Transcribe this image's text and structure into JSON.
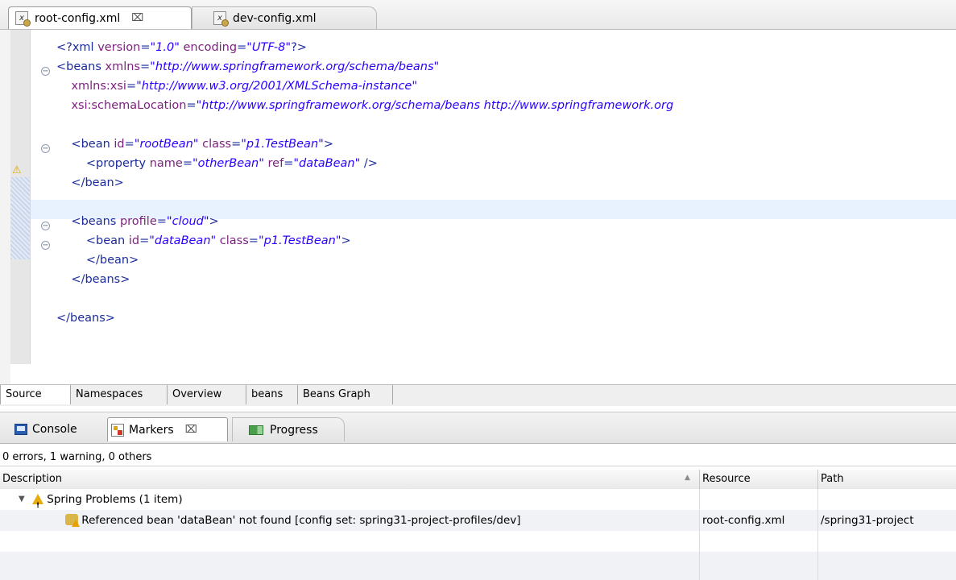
{
  "editor": {
    "tabs": [
      {
        "label": "root-config.xml",
        "close": "⌧"
      },
      {
        "label": "dev-config.xml"
      }
    ],
    "code_lines": [
      [
        {
          "t": "tag",
          "s": "<?xml "
        },
        {
          "t": "attr",
          "s": "version"
        },
        {
          "t": "tag",
          "s": "="
        },
        {
          "t": "val",
          "s": "\"1.0\""
        },
        {
          "t": "tag",
          "s": " "
        },
        {
          "t": "attr",
          "s": "encoding"
        },
        {
          "t": "tag",
          "s": "="
        },
        {
          "t": "val",
          "s": "\"UTF-8\""
        },
        {
          "t": "tag",
          "s": "?>"
        }
      ],
      [
        {
          "t": "tag",
          "s": "<beans "
        },
        {
          "t": "attr",
          "s": "xmlns"
        },
        {
          "t": "tag",
          "s": "="
        },
        {
          "t": "val",
          "s": "\"http://www.springframework.org/schema/beans\""
        }
      ],
      [
        {
          "t": "tag",
          "s": "    "
        },
        {
          "t": "attr",
          "s": "xmlns:xsi"
        },
        {
          "t": "tag",
          "s": "="
        },
        {
          "t": "val",
          "s": "\"http://www.w3.org/2001/XMLSchema-instance\""
        }
      ],
      [
        {
          "t": "tag",
          "s": "    "
        },
        {
          "t": "attr",
          "s": "xsi:schemaLocation"
        },
        {
          "t": "tag",
          "s": "="
        },
        {
          "t": "val",
          "s": "\"http://www.springframework.org/schema/beans http://www.springframework.org"
        }
      ],
      [],
      [
        {
          "t": "tag",
          "s": "    <bean "
        },
        {
          "t": "attr",
          "s": "id"
        },
        {
          "t": "tag",
          "s": "="
        },
        {
          "t": "val",
          "s": "\"rootBean\""
        },
        {
          "t": "tag",
          "s": " "
        },
        {
          "t": "attr",
          "s": "class"
        },
        {
          "t": "tag",
          "s": "="
        },
        {
          "t": "val",
          "s": "\"p1.TestBean\""
        },
        {
          "t": "tag",
          "s": ">"
        }
      ],
      [
        {
          "t": "tag",
          "s": "        <property "
        },
        {
          "t": "attr",
          "s": "name"
        },
        {
          "t": "tag",
          "s": "="
        },
        {
          "t": "val",
          "s": "\"otherBean\""
        },
        {
          "t": "tag",
          "s": " "
        },
        {
          "t": "attr",
          "s": "ref"
        },
        {
          "t": "tag",
          "s": "="
        },
        {
          "t": "val",
          "s": "\"dataBean\""
        },
        {
          "t": "tag",
          "s": " />"
        }
      ],
      [
        {
          "t": "tag",
          "s": "    </bean>"
        }
      ],
      [],
      [
        {
          "t": "tag",
          "s": "    <beans "
        },
        {
          "t": "attr",
          "s": "profile"
        },
        {
          "t": "tag",
          "s": "="
        },
        {
          "t": "val",
          "s": "\"cloud\""
        },
        {
          "t": "tag",
          "s": ">"
        }
      ],
      [
        {
          "t": "tag",
          "s": "        <bean "
        },
        {
          "t": "attr",
          "s": "id"
        },
        {
          "t": "tag",
          "s": "="
        },
        {
          "t": "val",
          "s": "\"dataBean\""
        },
        {
          "t": "tag",
          "s": " "
        },
        {
          "t": "attr",
          "s": "class"
        },
        {
          "t": "tag",
          "s": "="
        },
        {
          "t": "val",
          "s": "\"p1.TestBean\""
        },
        {
          "t": "tag",
          "s": ">"
        }
      ],
      [
        {
          "t": "tag",
          "s": "        </bean>"
        }
      ],
      [
        {
          "t": "tag",
          "s": "    </beans>"
        }
      ],
      [],
      [
        {
          "t": "tag",
          "s": "</beans>"
        }
      ]
    ],
    "page_tabs": [
      "Source",
      "Namespaces",
      "Overview",
      "beans",
      "Beans Graph"
    ]
  },
  "views": {
    "tabs": [
      {
        "label": "Console"
      },
      {
        "label": "Markers",
        "close": "⌧"
      },
      {
        "label": "Progress"
      }
    ]
  },
  "markers": {
    "summary": "0 errors, 1 warning, 0 others",
    "columns": [
      "Description",
      "Resource",
      "Path"
    ],
    "group": "Spring Problems (1 item)",
    "items": [
      {
        "description": "Referenced bean 'dataBean' not found [config set: spring31-project-profiles/dev]",
        "resource": "root-config.xml",
        "path": "/spring31-project"
      }
    ]
  },
  "colors": {
    "tag": "#1b2c9c",
    "attribute": "#7d1f7f",
    "value": "#2a00ff",
    "warning": "#e8ad0c",
    "current_line": "#e8f2fe"
  }
}
